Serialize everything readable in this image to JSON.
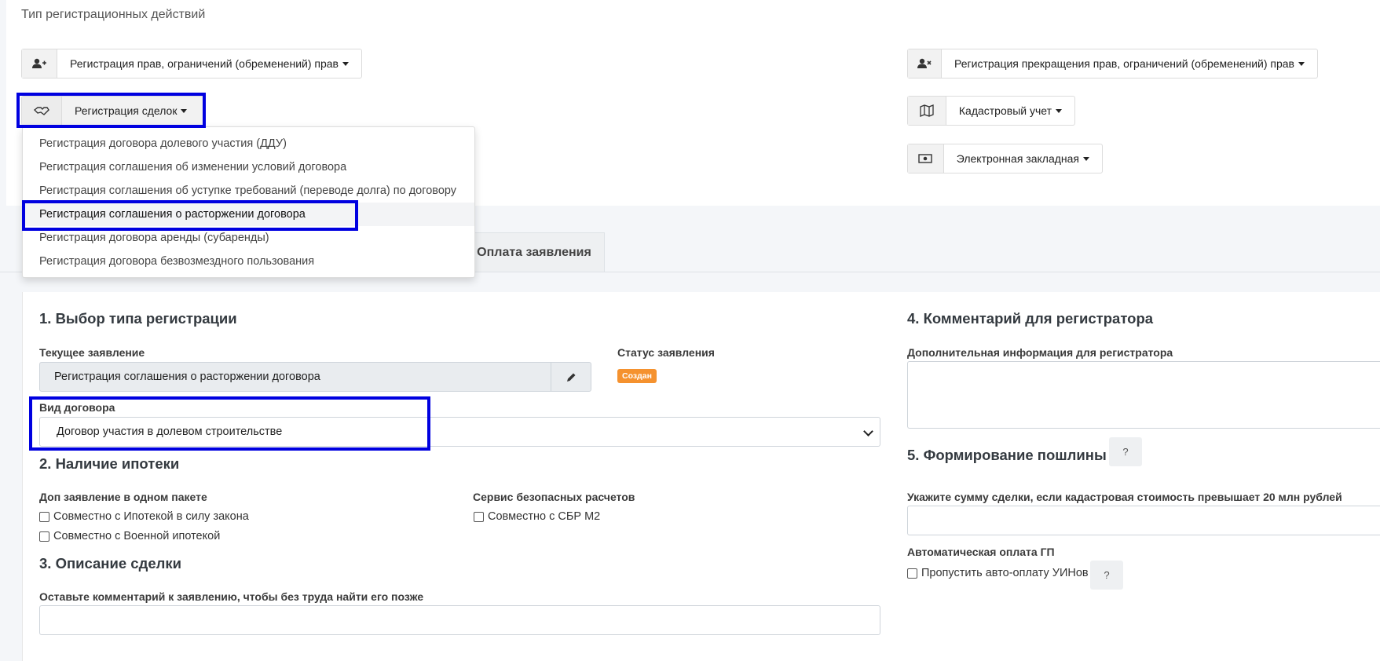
{
  "top": {
    "section_title": "Тип регистрационных действий",
    "buttons": {
      "rights": "Регистрация прав, ограничений (обременений) прав",
      "deals": "Регистрация сделок",
      "termination": "Регистрация прекращения прав, ограничений (обременений) прав",
      "cadastral": "Кадастровый учет",
      "mortgage_e": "Электронная закладная"
    },
    "icons": {
      "rights": "user-plus-icon",
      "deals": "handshake-icon",
      "termination": "user-times-icon",
      "cadastral": "map-icon",
      "mortgage_e": "money-bill-icon"
    }
  },
  "dropdown": {
    "items": [
      "Регистрация договора долевого участия (ДДУ)",
      "Регистрация соглашения об изменении условий договора",
      "Регистрация соглашения об уступке требований (переводе долга) по договору",
      "Регистрация соглашения о расторжении договора",
      "Регистрация договора аренды (субаренды)",
      "Регистрация договора безвозмездного пользования"
    ],
    "selected_index": 3
  },
  "tabs": {
    "payment": "Оплата заявления"
  },
  "form": {
    "s1_title": "1. Выбор типа регистрации",
    "current_label": "Текущее заявление",
    "current_value": "Регистрация соглашения о расторжении договора",
    "status_label": "Статус заявления",
    "status_value": "Создан",
    "contract_label": "Вид договора",
    "contract_value": "Договор участия в долевом строительстве",
    "s2_title": "2. Наличие ипотеки",
    "extra_label": "Доп заявление в одном пакете",
    "cb_mortgage_law": "Совместно с Ипотекой в силу закона",
    "cb_military": "Совместно с Военной ипотекой",
    "safe_label": "Сервис безопасных расчетов",
    "cb_sbr": "Совместно с СБР М2",
    "s3_title": "3. Описание сделки",
    "comment_label": "Оставьте комментарий к заявлению, чтобы без труда найти его позже",
    "s4_title": "4. Комментарий для регистратора",
    "reg_info_label": "Дополнительная информация для регистратора",
    "s5_title": "5. Формирование пошлины",
    "help": "?",
    "amount_label": "Укажите сумму сделки, если кадастровая стоимость превышает 20 млн рублей",
    "auto_label": "Автоматическая оплата ГП",
    "cb_skip": "Пропустить авто-оплату УИНов"
  },
  "colors": {
    "highlight": "#0000e0",
    "badge": "#f5922f"
  }
}
